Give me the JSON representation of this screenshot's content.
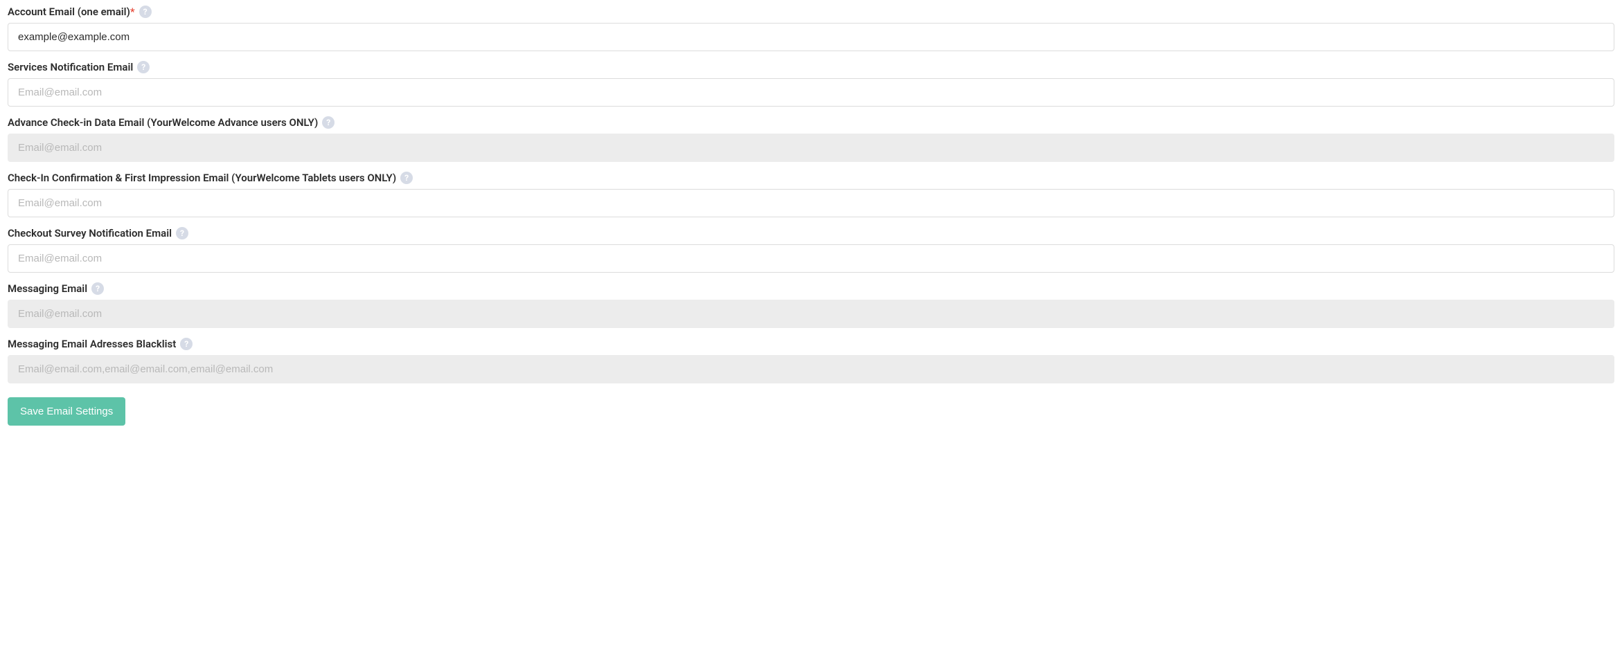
{
  "fields": {
    "accountEmail": {
      "label": "Account Email (one email)",
      "required": true,
      "value": "example@example.com",
      "placeholder": ""
    },
    "servicesNotification": {
      "label": "Services Notification Email",
      "required": false,
      "value": "",
      "placeholder": "Email@email.com"
    },
    "advanceCheckin": {
      "label": "Advance Check-in Data Email (YourWelcome Advance users ONLY)",
      "required": false,
      "value": "",
      "placeholder": "Email@email.com",
      "disabled": true
    },
    "checkinConfirmation": {
      "label": "Check-In Confirmation & First Impression Email (YourWelcome Tablets users ONLY)",
      "required": false,
      "value": "",
      "placeholder": "Email@email.com"
    },
    "checkoutSurvey": {
      "label": "Checkout Survey Notification Email",
      "required": false,
      "value": "",
      "placeholder": "Email@email.com"
    },
    "messagingEmail": {
      "label": "Messaging Email",
      "required": false,
      "value": "",
      "placeholder": "Email@email.com",
      "disabled": true
    },
    "messagingBlacklist": {
      "label": "Messaging Email Adresses Blacklist",
      "required": false,
      "value": "",
      "placeholder": "Email@email.com,email@email.com,email@email.com",
      "disabled": true
    }
  },
  "buttons": {
    "save": "Save Email Settings"
  },
  "helpGlyph": "?"
}
